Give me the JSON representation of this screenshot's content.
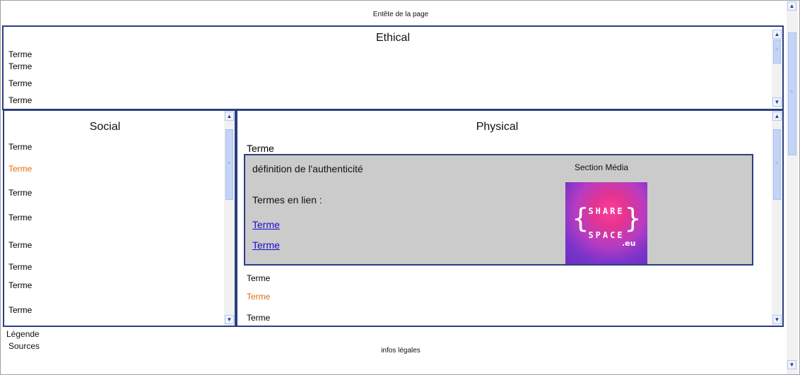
{
  "header": {
    "title": "Entête de la page"
  },
  "ethical": {
    "title": "Ethical",
    "terms": [
      "Terme",
      "Terme",
      "Terme",
      "Terme"
    ]
  },
  "social": {
    "title": "Social",
    "terms": [
      "Terme",
      "Terme",
      "Terme",
      "Terme",
      "Terme",
      "Terme",
      "Terme",
      "Terme"
    ],
    "highlighted_index": 1
  },
  "physical": {
    "title": "Physical",
    "selected_term": "Terme",
    "card": {
      "definition": "définition de l'authenticité",
      "related_label": "Termes en lien :",
      "links": [
        "Terme",
        "Terme"
      ],
      "media_section_title": "Section Média",
      "media_logo": {
        "line1": "SHARE",
        "line2": "SPACE",
        "suffix": ".eu"
      }
    },
    "terms_after": [
      "Terme",
      "Terme",
      "Terme"
    ],
    "highlighted_after_index": 1
  },
  "footer": {
    "legend": "Légende",
    "sources": "Sources",
    "legal": "infos légales"
  },
  "colors": {
    "panel_border": "#2b3f80",
    "highlight_term": "#e06a10",
    "card_background": "#cbcbcb",
    "link": "#1a0dcc"
  },
  "icons": [
    "scroll-up-arrow-icon",
    "scroll-down-arrow-icon",
    "scroll-thumb-grip-icon"
  ]
}
